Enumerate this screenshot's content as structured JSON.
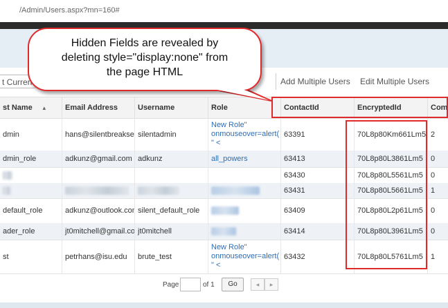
{
  "browser": {
    "url": "/Admin/Users.aspx?mn=160#"
  },
  "toolbar": {
    "search_value": "t Curren",
    "add_multiple": "Add Multiple Users",
    "edit_multiple": "Edit Multiple Users"
  },
  "columns": {
    "last_name": "st Name",
    "sort_arrow": "▲",
    "email": "Email Address",
    "username": "Username",
    "role": "Role",
    "contact_id": "ContactId",
    "encrypted_id": "EncryptedId",
    "comp": "Comp"
  },
  "rows": [
    {
      "name": "dmin",
      "email": "hans@silentbreaksec",
      "username": "silentadmin",
      "role_l1": "New Role\"",
      "role_l2": "onmouseover=alert(",
      "role_l3": "\" <",
      "contact": "63391",
      "enc": "70L8p80Km661Lm5",
      "comp": "2"
    },
    {
      "name": "dmin_role",
      "email": "adkunz@gmail.com",
      "username": "adkunz",
      "role_l1": "all_powers",
      "contact": "63413",
      "enc": "70L8p80L3861Lm5",
      "comp": "0"
    },
    {
      "contact": "63430",
      "enc": "70L8p80L5561Lm5",
      "comp": "0"
    },
    {
      "contact": "63431",
      "enc": "70L8p80L5661Lm5",
      "comp": "1"
    },
    {
      "name": "default_role",
      "email": "adkunz@outlook.com",
      "username": "silent_default_role",
      "contact": "63409",
      "enc": "70L8p80L2p61Lm5",
      "comp": "0"
    },
    {
      "name": "ader_role",
      "email": "jt0mitchell@gmail.co",
      "username": "jt0mitchell",
      "contact": "63414",
      "enc": "70L8p80L3961Lm5",
      "comp": "0"
    },
    {
      "name": "st",
      "email": "petrhans@isu.edu",
      "username": "brute_test",
      "role_l1": "New Role\"",
      "role_l2": "onmouseover=alert(",
      "role_l3": "\" <",
      "contact": "63432",
      "enc": "70L8p80L5761Lm5",
      "comp": "1"
    }
  ],
  "pager": {
    "page_label": "Page",
    "of_label": "of 1",
    "go_label": "Go",
    "prev": "◂",
    "next": "▸"
  },
  "callout": {
    "line1": "Hidden Fields are revealed by",
    "line2": "deleting style=\"display:none\" from",
    "line3": "the page HTML"
  },
  "colors": {
    "highlight": "#e0292b",
    "link": "#2a6ebb",
    "header_bg": "#f3f3f3",
    "alt_row": "#eef2f7"
  }
}
